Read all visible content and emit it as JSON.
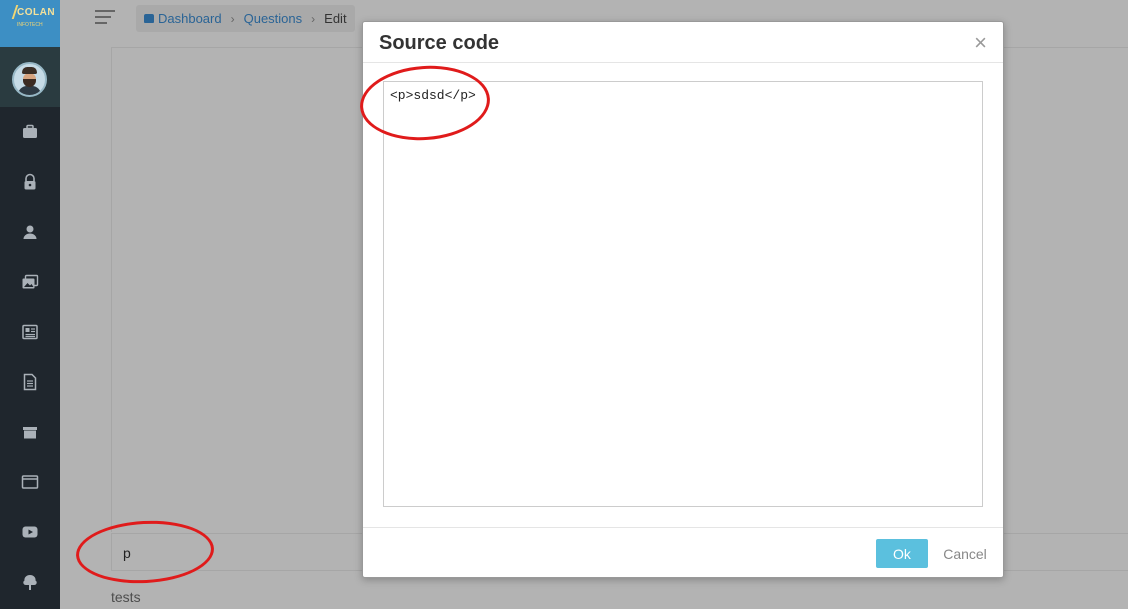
{
  "logo": {
    "text": "COLAN",
    "subtext": "INFOTECH"
  },
  "sidebar": {
    "items": [
      {
        "icon": "briefcase-icon"
      },
      {
        "icon": "lock-icon"
      },
      {
        "icon": "user-icon"
      },
      {
        "icon": "images-icon"
      },
      {
        "icon": "newspaper-icon"
      },
      {
        "icon": "document-icon"
      },
      {
        "icon": "archive-icon"
      },
      {
        "icon": "browser-window-icon"
      },
      {
        "icon": "video-play-icon"
      },
      {
        "icon": "tree-icon"
      }
    ]
  },
  "breadcrumb": {
    "items": [
      "Dashboard",
      "Questions",
      "Edit"
    ]
  },
  "editor": {
    "path_text": "p",
    "field_label": "tests"
  },
  "modal": {
    "title": "Source code",
    "close_symbol": "×",
    "source": "<p>sdsd</p>",
    "ok_label": "Ok",
    "cancel_label": "Cancel"
  },
  "colors": {
    "sidebar_bg": "#1f262d",
    "logo_bg": "#3d8fc4",
    "ok_button": "#5bc0de",
    "annotation": "#e01b1b",
    "overlay": "#b3b3b3"
  }
}
